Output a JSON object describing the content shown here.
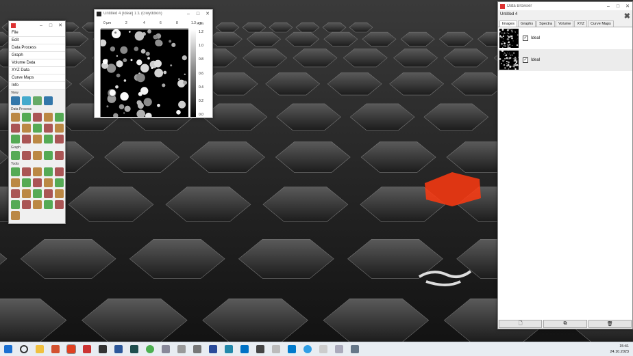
{
  "toolbox": {
    "menus": [
      "File",
      "Edit",
      "Data Process",
      "Graph",
      "Volume Data",
      "XYZ Data",
      "Curve Maps",
      "Info"
    ],
    "sections": {
      "view": "View",
      "data_process": "Data Process",
      "graph": "Graph",
      "tools": "Tools"
    }
  },
  "image_window": {
    "title": "Untitled 4 [Ideal] 1:1 (Gwyddion)",
    "ruler_ticks": [
      "0 µm",
      "2",
      "4",
      "6",
      "8",
      "1.3 µm"
    ],
    "colorbar_labels": [
      "1.2",
      "1.0",
      "0.8",
      "0.6",
      "0.4",
      "0.2",
      "0.0"
    ],
    "colorbar_unit": "µm"
  },
  "data_browser": {
    "title": "Data Browser",
    "project": "Untitled 4",
    "tabs": [
      "Images",
      "Graphs",
      "Spectra",
      "Volume",
      "XYZ",
      "Curve Maps"
    ],
    "active_tab": "Images",
    "items": [
      {
        "name": "Ideal",
        "checked": true
      },
      {
        "name": "Ideal",
        "checked": true
      }
    ]
  },
  "taskbar": {
    "time": "15:41",
    "date": "24.10.2023"
  },
  "colors": {
    "accent": "#e0562a",
    "hex_red": "#ff3a10"
  }
}
